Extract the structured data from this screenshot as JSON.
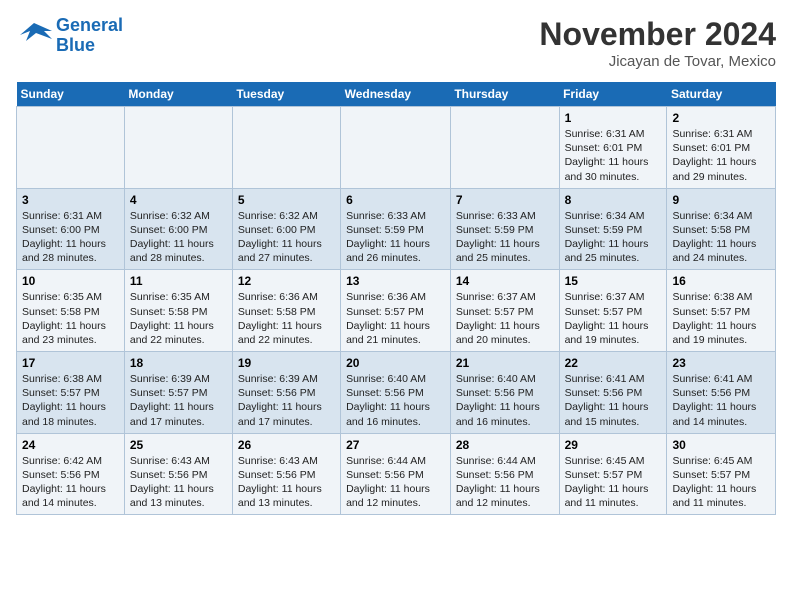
{
  "logo": {
    "line1": "General",
    "line2": "Blue"
  },
  "title": "November 2024",
  "location": "Jicayan de Tovar, Mexico",
  "weekdays": [
    "Sunday",
    "Monday",
    "Tuesday",
    "Wednesday",
    "Thursday",
    "Friday",
    "Saturday"
  ],
  "weeks": [
    [
      {
        "day": "",
        "info": ""
      },
      {
        "day": "",
        "info": ""
      },
      {
        "day": "",
        "info": ""
      },
      {
        "day": "",
        "info": ""
      },
      {
        "day": "",
        "info": ""
      },
      {
        "day": "1",
        "info": "Sunrise: 6:31 AM\nSunset: 6:01 PM\nDaylight: 11 hours and 30 minutes."
      },
      {
        "day": "2",
        "info": "Sunrise: 6:31 AM\nSunset: 6:01 PM\nDaylight: 11 hours and 29 minutes."
      }
    ],
    [
      {
        "day": "3",
        "info": "Sunrise: 6:31 AM\nSunset: 6:00 PM\nDaylight: 11 hours and 28 minutes."
      },
      {
        "day": "4",
        "info": "Sunrise: 6:32 AM\nSunset: 6:00 PM\nDaylight: 11 hours and 28 minutes."
      },
      {
        "day": "5",
        "info": "Sunrise: 6:32 AM\nSunset: 6:00 PM\nDaylight: 11 hours and 27 minutes."
      },
      {
        "day": "6",
        "info": "Sunrise: 6:33 AM\nSunset: 5:59 PM\nDaylight: 11 hours and 26 minutes."
      },
      {
        "day": "7",
        "info": "Sunrise: 6:33 AM\nSunset: 5:59 PM\nDaylight: 11 hours and 25 minutes."
      },
      {
        "day": "8",
        "info": "Sunrise: 6:34 AM\nSunset: 5:59 PM\nDaylight: 11 hours and 25 minutes."
      },
      {
        "day": "9",
        "info": "Sunrise: 6:34 AM\nSunset: 5:58 PM\nDaylight: 11 hours and 24 minutes."
      }
    ],
    [
      {
        "day": "10",
        "info": "Sunrise: 6:35 AM\nSunset: 5:58 PM\nDaylight: 11 hours and 23 minutes."
      },
      {
        "day": "11",
        "info": "Sunrise: 6:35 AM\nSunset: 5:58 PM\nDaylight: 11 hours and 22 minutes."
      },
      {
        "day": "12",
        "info": "Sunrise: 6:36 AM\nSunset: 5:58 PM\nDaylight: 11 hours and 22 minutes."
      },
      {
        "day": "13",
        "info": "Sunrise: 6:36 AM\nSunset: 5:57 PM\nDaylight: 11 hours and 21 minutes."
      },
      {
        "day": "14",
        "info": "Sunrise: 6:37 AM\nSunset: 5:57 PM\nDaylight: 11 hours and 20 minutes."
      },
      {
        "day": "15",
        "info": "Sunrise: 6:37 AM\nSunset: 5:57 PM\nDaylight: 11 hours and 19 minutes."
      },
      {
        "day": "16",
        "info": "Sunrise: 6:38 AM\nSunset: 5:57 PM\nDaylight: 11 hours and 19 minutes."
      }
    ],
    [
      {
        "day": "17",
        "info": "Sunrise: 6:38 AM\nSunset: 5:57 PM\nDaylight: 11 hours and 18 minutes."
      },
      {
        "day": "18",
        "info": "Sunrise: 6:39 AM\nSunset: 5:57 PM\nDaylight: 11 hours and 17 minutes."
      },
      {
        "day": "19",
        "info": "Sunrise: 6:39 AM\nSunset: 5:56 PM\nDaylight: 11 hours and 17 minutes."
      },
      {
        "day": "20",
        "info": "Sunrise: 6:40 AM\nSunset: 5:56 PM\nDaylight: 11 hours and 16 minutes."
      },
      {
        "day": "21",
        "info": "Sunrise: 6:40 AM\nSunset: 5:56 PM\nDaylight: 11 hours and 16 minutes."
      },
      {
        "day": "22",
        "info": "Sunrise: 6:41 AM\nSunset: 5:56 PM\nDaylight: 11 hours and 15 minutes."
      },
      {
        "day": "23",
        "info": "Sunrise: 6:41 AM\nSunset: 5:56 PM\nDaylight: 11 hours and 14 minutes."
      }
    ],
    [
      {
        "day": "24",
        "info": "Sunrise: 6:42 AM\nSunset: 5:56 PM\nDaylight: 11 hours and 14 minutes."
      },
      {
        "day": "25",
        "info": "Sunrise: 6:43 AM\nSunset: 5:56 PM\nDaylight: 11 hours and 13 minutes."
      },
      {
        "day": "26",
        "info": "Sunrise: 6:43 AM\nSunset: 5:56 PM\nDaylight: 11 hours and 13 minutes."
      },
      {
        "day": "27",
        "info": "Sunrise: 6:44 AM\nSunset: 5:56 PM\nDaylight: 11 hours and 12 minutes."
      },
      {
        "day": "28",
        "info": "Sunrise: 6:44 AM\nSunset: 5:56 PM\nDaylight: 11 hours and 12 minutes."
      },
      {
        "day": "29",
        "info": "Sunrise: 6:45 AM\nSunset: 5:57 PM\nDaylight: 11 hours and 11 minutes."
      },
      {
        "day": "30",
        "info": "Sunrise: 6:45 AM\nSunset: 5:57 PM\nDaylight: 11 hours and 11 minutes."
      }
    ]
  ]
}
